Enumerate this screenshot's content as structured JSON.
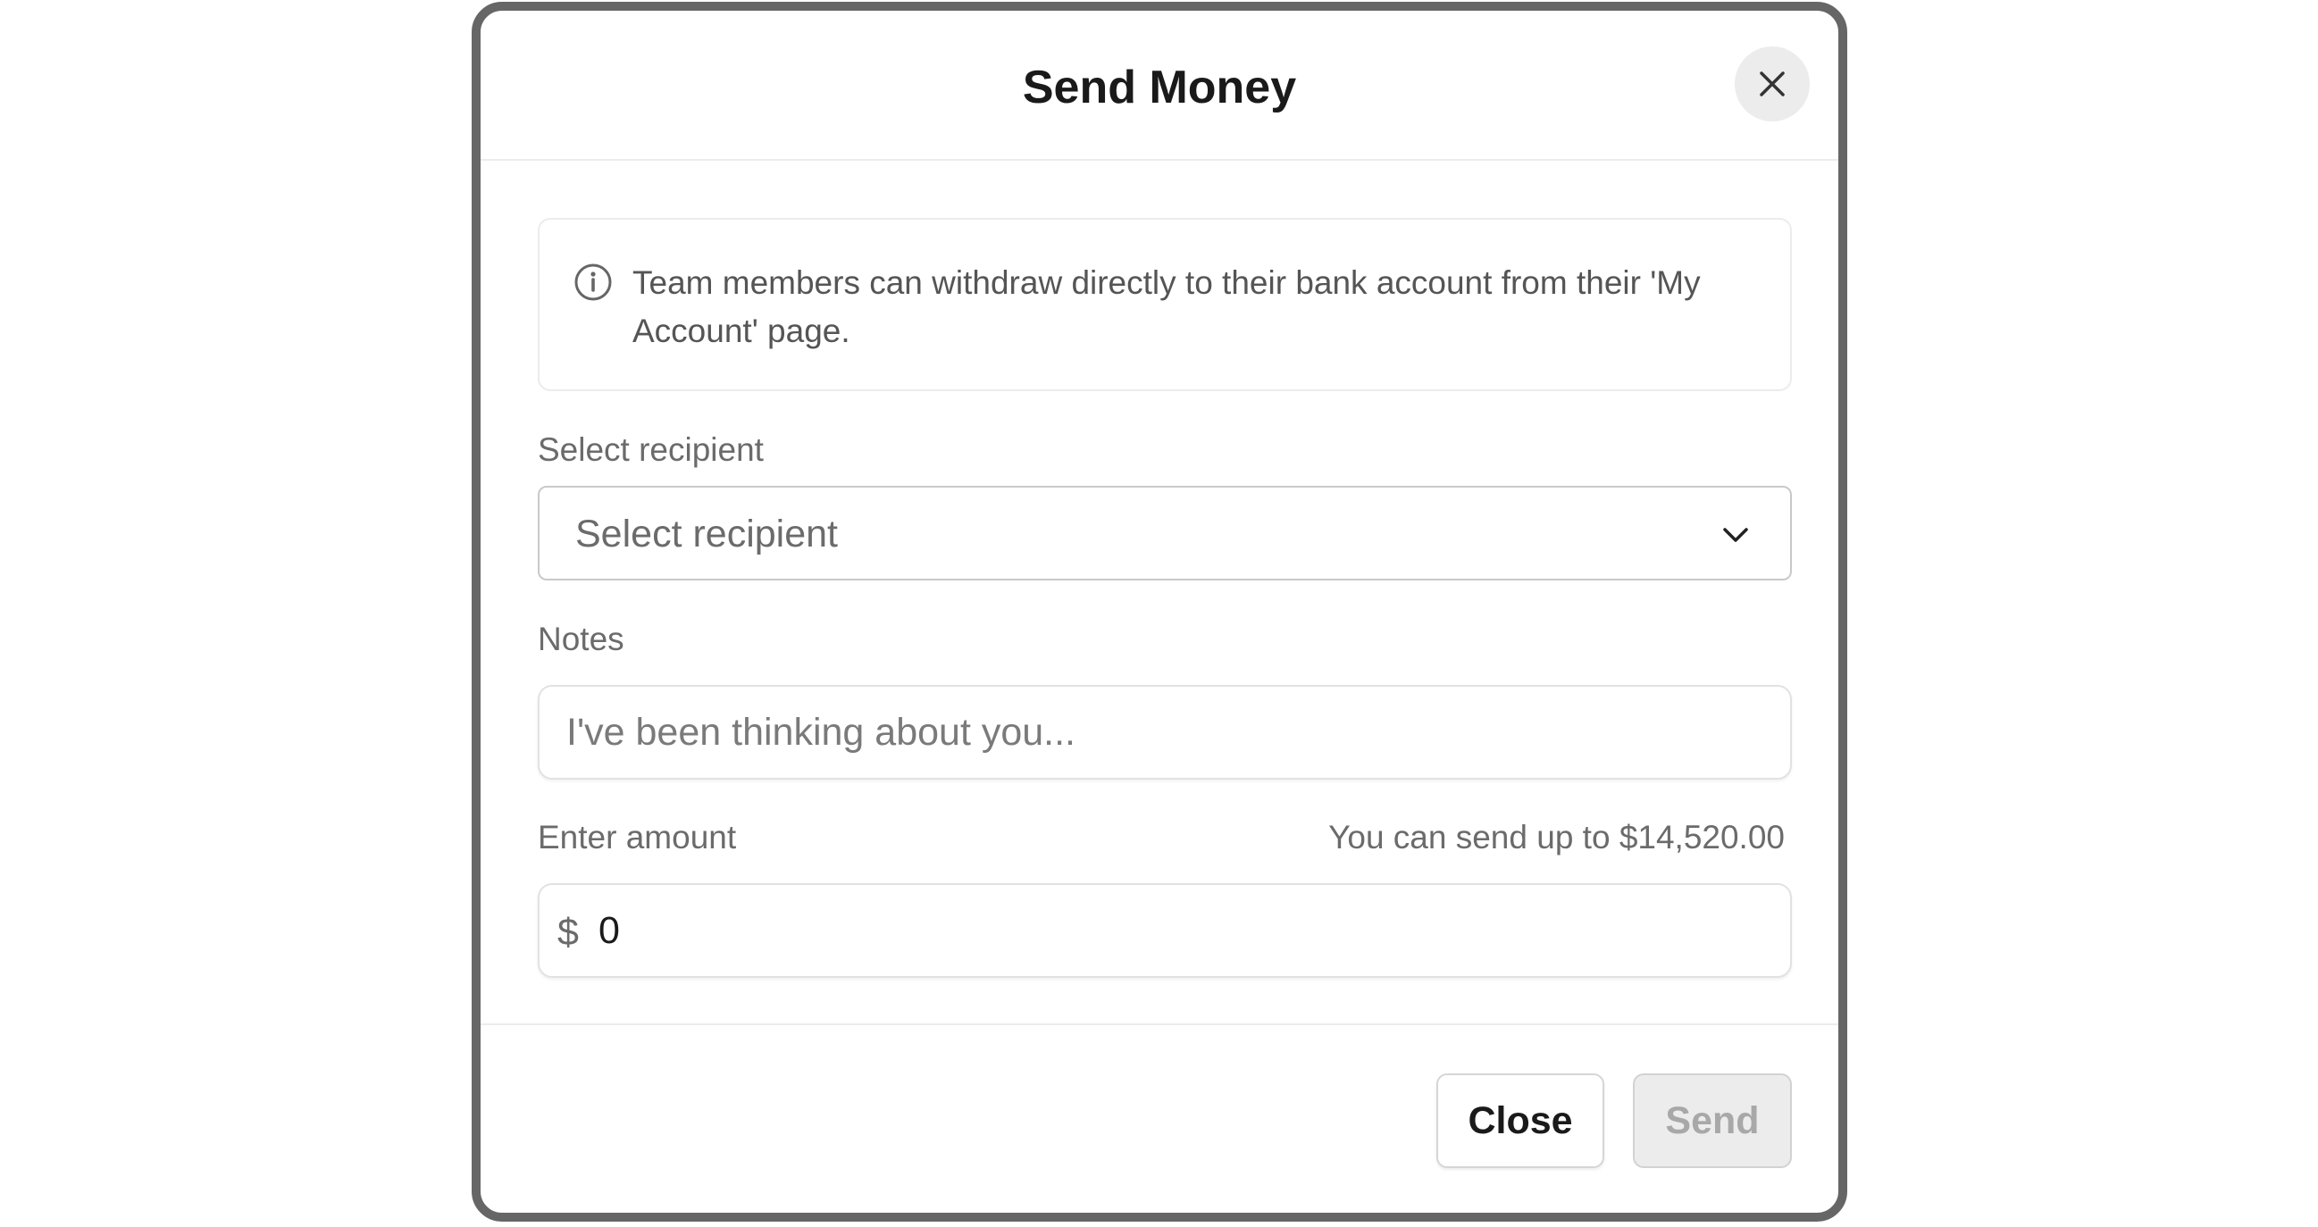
{
  "dialog": {
    "title": "Send Money",
    "close_icon": "close-icon"
  },
  "info": {
    "icon": "info-icon",
    "text": "Team members can withdraw directly to their bank account from their 'My Account' page."
  },
  "recipient": {
    "label": "Select recipient",
    "placeholder": "Select recipient",
    "icon": "chevron-down-icon"
  },
  "notes": {
    "label": "Notes",
    "placeholder": "I've been thinking about you..."
  },
  "amount": {
    "label": "Enter amount",
    "limit_text": "You can send up to $14,520.00",
    "currency_symbol": "$",
    "value": "0"
  },
  "footer": {
    "close_label": "Close",
    "send_label": "Send"
  }
}
